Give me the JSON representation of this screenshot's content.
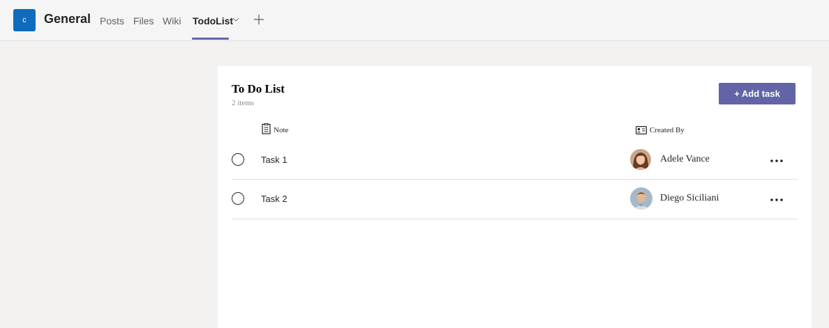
{
  "header": {
    "team_badge": "c",
    "channel": "General",
    "tabs": [
      {
        "label": "Posts"
      },
      {
        "label": "Files"
      },
      {
        "label": "Wiki"
      },
      {
        "label": "TodoList"
      }
    ],
    "active_tab": "TodoList"
  },
  "list": {
    "title": "To Do List",
    "count": "2 items",
    "add_button": "+ Add task",
    "columns": {
      "note": "Note",
      "created_by": "Created By"
    },
    "rows": [
      {
        "task": "Task 1",
        "creator": "Adele Vance"
      },
      {
        "task": "Task 2",
        "creator": "Diego Siciliani"
      }
    ]
  },
  "colors": {
    "accent": "#6264a7",
    "team_badge": "#0f6cbd"
  },
  "icons": [
    "chevron-down-icon",
    "plus-icon",
    "note-icon",
    "contact-card-icon",
    "more-icon"
  ]
}
